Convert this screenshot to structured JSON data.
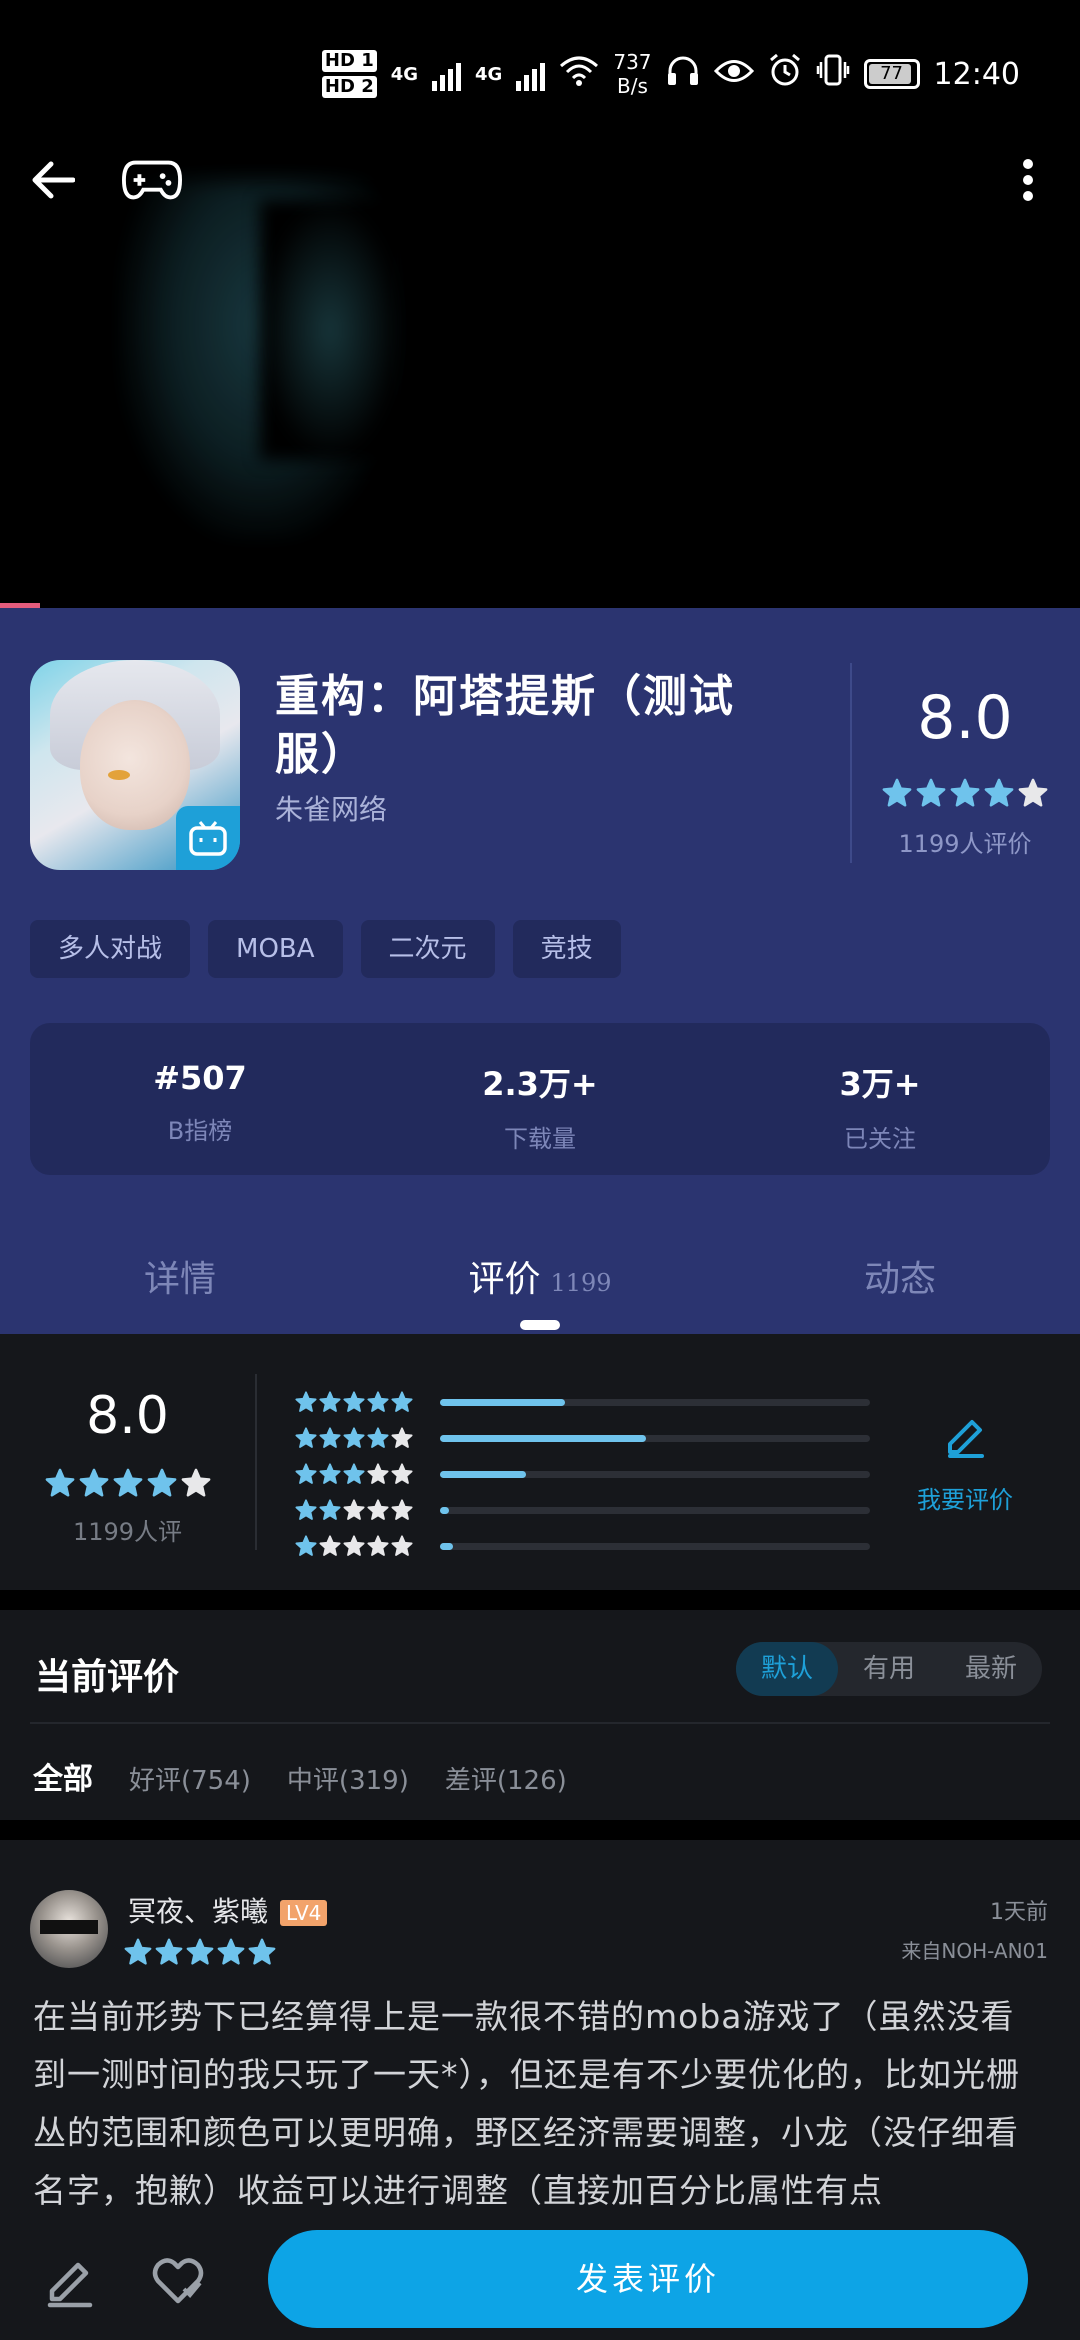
{
  "status_bar": {
    "hd1": "HD 1",
    "hd2": "HD 2",
    "net1": "4G",
    "net2": "4G",
    "speed_value": "737",
    "speed_unit": "B/s",
    "battery": "77",
    "time": "12:40"
  },
  "app": {
    "title": "重构：阿塔提斯（测试服）",
    "developer": "朱雀网络",
    "rating": "8.0",
    "rating_count": "1199人评价",
    "tags": [
      "多人对战",
      "MOBA",
      "二次元",
      "竞技"
    ],
    "stats": [
      {
        "value": "#507",
        "label": "B指榜"
      },
      {
        "value": "2.3万+",
        "label": "下载量"
      },
      {
        "value": "3万+",
        "label": "已关注"
      }
    ]
  },
  "tabs": {
    "details": "详情",
    "reviews": "评价",
    "reviews_count": "1199",
    "activity": "动态"
  },
  "rating_summary": {
    "score": "8.0",
    "count": "1199人评",
    "write_label": "我要评价",
    "distribution": [
      {
        "stars": 5,
        "fraction": 0.29
      },
      {
        "stars": 4,
        "fraction": 0.48
      },
      {
        "stars": 3,
        "fraction": 0.2
      },
      {
        "stars": 2,
        "fraction": 0.02
      },
      {
        "stars": 1,
        "fraction": 0.03
      }
    ]
  },
  "reviews_section": {
    "title": "当前评价",
    "sort": [
      "默认",
      "有用",
      "最新"
    ],
    "filters": {
      "all": "全部",
      "good": "好评(754)",
      "mid": "中评(319)",
      "bad": "差评(126)"
    }
  },
  "review": {
    "username": "冥夜、紫曦",
    "level": "LV4",
    "stars": 5,
    "time": "1天前",
    "device": "来自NOH-AN01",
    "body": "在当前形势下已经算得上是一款很不错的moba游戏了（虽然没看到一测时间的我只玩了一天*），但还是有不少要优化的，比如光栅丛的范围和颜色可以更明确，野区经济需要调整，小龙（没仔细看名字，抱歉）收益可以进行调整（直接加百分比属性有点"
  },
  "bottom": {
    "post_label": "发表评价"
  },
  "colors": {
    "panel": "#2b3470",
    "accent": "#0da4e6",
    "star": "#6fc3ec"
  }
}
